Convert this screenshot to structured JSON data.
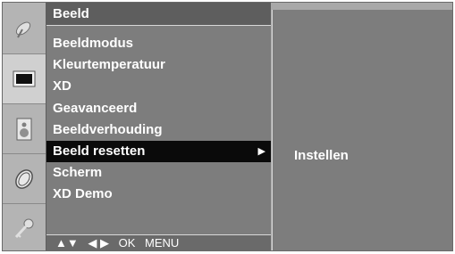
{
  "menu": {
    "title": "Beeld",
    "items": [
      {
        "label": "Beeldmodus"
      },
      {
        "label": "Kleurtemperatuur"
      },
      {
        "label": "XD"
      },
      {
        "label": "Geavanceerd"
      },
      {
        "label": "Beeldverhouding"
      },
      {
        "label": "Beeld resetten",
        "selected": true,
        "arrow": "▶"
      },
      {
        "label": "Scherm"
      },
      {
        "label": "XD Demo"
      }
    ]
  },
  "submenu": {
    "items": [
      {
        "label": "Instellen"
      }
    ]
  },
  "footer": {
    "nav_updown": "▲▼",
    "nav_leftright": "◀ ▶",
    "ok": "OK",
    "menu": "MENU"
  },
  "icons": [
    "satellite-dish-icon",
    "picture-icon",
    "speaker-icon",
    "timer-icon",
    "key-icon"
  ],
  "colors": {
    "panel": "#7d7d7d",
    "selected_bg": "#0a0a0a",
    "text": "#ffffff"
  }
}
